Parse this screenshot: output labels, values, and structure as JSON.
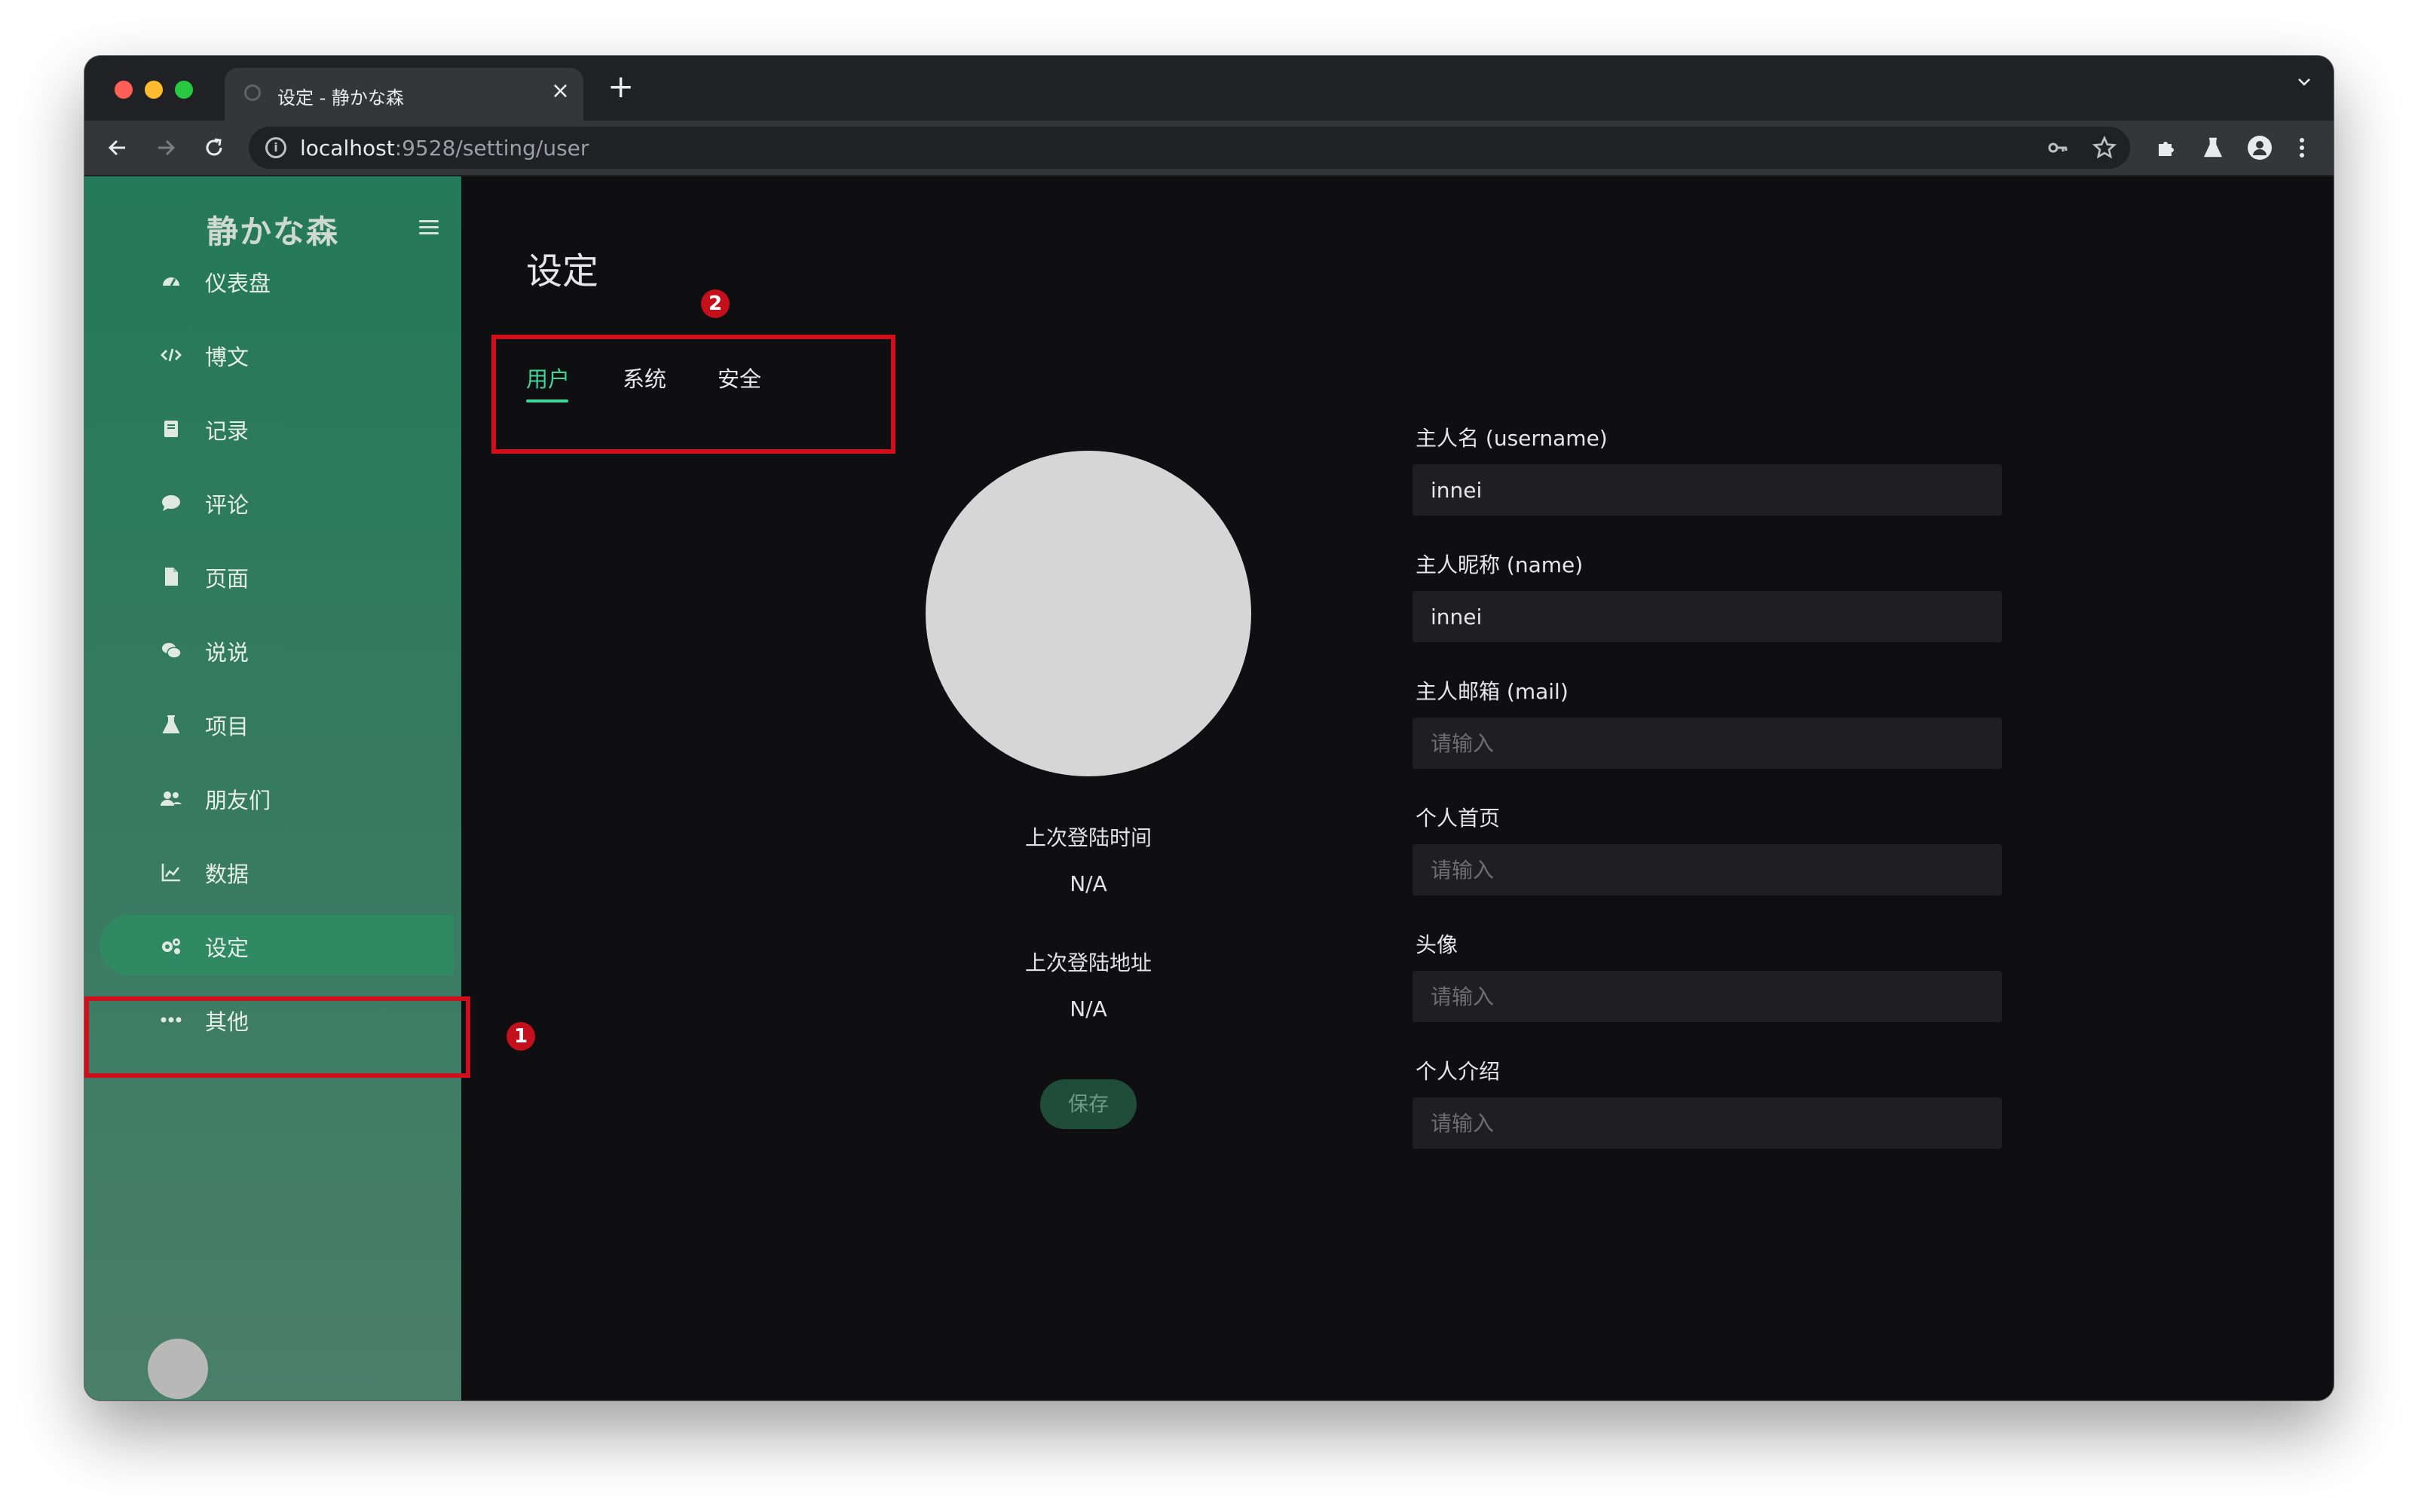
{
  "browser": {
    "tab_title": "设定 - 静かな森",
    "url_host": "localhost",
    "url_path": ":9528/setting/user"
  },
  "sidebar": {
    "brand": "静かな森",
    "items": [
      {
        "label": "仪表盘",
        "icon": "dashboard-icon"
      },
      {
        "label": "博文",
        "icon": "code-icon"
      },
      {
        "label": "记录",
        "icon": "book-icon"
      },
      {
        "label": "评论",
        "icon": "comment-icon"
      },
      {
        "label": "页面",
        "icon": "file-icon"
      },
      {
        "label": "说说",
        "icon": "chat-icon"
      },
      {
        "label": "项目",
        "icon": "flask-icon"
      },
      {
        "label": "朋友们",
        "icon": "users-icon"
      },
      {
        "label": "数据",
        "icon": "chart-icon"
      },
      {
        "label": "设定",
        "icon": "settings-icon",
        "active": true
      },
      {
        "label": "其他",
        "icon": "more-icon"
      }
    ]
  },
  "main": {
    "title": "设定",
    "tabs": [
      {
        "label": "用户",
        "active": true
      },
      {
        "label": "系统"
      },
      {
        "label": "安全"
      }
    ],
    "last_login_time_label": "上次登陆时间",
    "last_login_time_value": "N/A",
    "last_login_addr_label": "上次登陆地址",
    "last_login_addr_value": "N/A",
    "save_label": "保存",
    "fields": [
      {
        "label": "主人名 (username)",
        "value": "innei",
        "placeholder": "请输入"
      },
      {
        "label": "主人昵称 (name)",
        "value": "innei",
        "placeholder": "请输入"
      },
      {
        "label": "主人邮箱 (mail)",
        "value": "",
        "placeholder": "请输入"
      },
      {
        "label": "个人首页",
        "value": "",
        "placeholder": "请输入"
      },
      {
        "label": "头像",
        "value": "",
        "placeholder": "请输入"
      },
      {
        "label": "个人介绍",
        "value": "",
        "placeholder": "请输入"
      }
    ]
  },
  "annotations": {
    "marker_1": "1",
    "marker_2": "2"
  },
  "colors": {
    "accent": "#3fd49a",
    "sidebar": "#2a7a5c",
    "annotation": "#d10f1c"
  }
}
